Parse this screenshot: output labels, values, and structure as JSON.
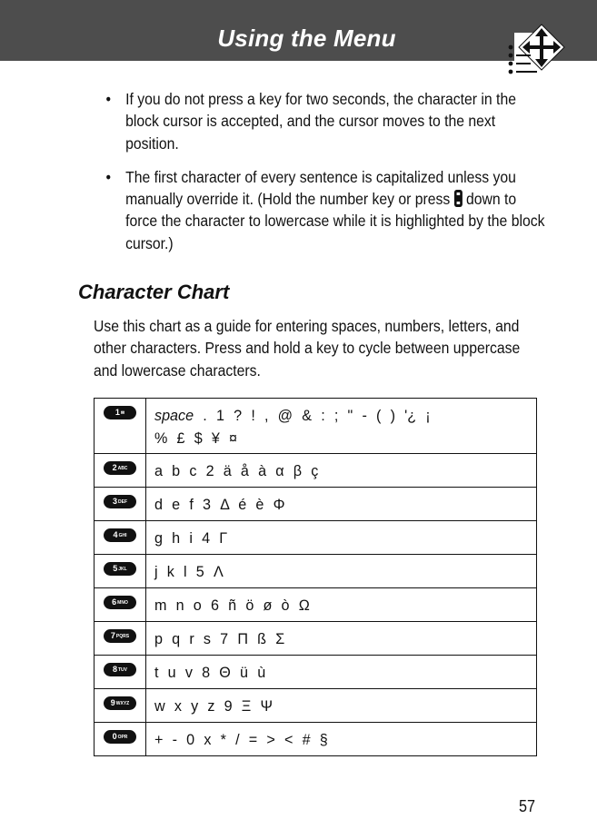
{
  "header": {
    "title": "Using the Menu",
    "icon": "menu-navigation-icon",
    "background_color": "#4d4d4d"
  },
  "bullets": [
    {
      "text": "If you do not press a key for two seconds, the character in the block cursor is accepted, and the cursor moves to the next position."
    },
    {
      "text_before_icon": "The first character of every sentence is capitalized unless you manually override it. (Hold the number key or press ",
      "icon": "navigation-key-icon",
      "text_after_icon": " down to force the character to lowercase while it is highlighted by the block cursor.)"
    }
  ],
  "section": {
    "title": "Character Chart",
    "intro": "Use this chart as a guide for entering spaces, numbers, letters, and other characters. Press and hold a key to cycle between uppercase and lowercase characters."
  },
  "chart_rows": [
    {
      "key": "1",
      "key_sub": "✉",
      "first_italic": "space",
      "chars": ". 1 ? ! , @ & : ; \" - ( ) '¿ ¡",
      "chars_line2": "% £ $ ¥ ¤"
    },
    {
      "key": "2",
      "key_sub": "ABC",
      "chars": "a b c 2 ä å à α β ç"
    },
    {
      "key": "3",
      "key_sub": "DEF",
      "chars": "d e f 3 Δ é è Φ"
    },
    {
      "key": "4",
      "key_sub": "GHI",
      "chars": "g h i 4 Γ"
    },
    {
      "key": "5",
      "key_sub": "JKL",
      "chars": "j k l 5 Λ"
    },
    {
      "key": "6",
      "key_sub": "MNO",
      "chars": "m n o 6 ñ ö ø ò Ω"
    },
    {
      "key": "7",
      "key_sub": "PQRS",
      "chars": "p q r s 7 Π ß Σ"
    },
    {
      "key": "8",
      "key_sub": "TUV",
      "chars": "t u v 8 Θ ü ù"
    },
    {
      "key": "9",
      "key_sub": "WXYZ",
      "chars": "w x y z 9 Ξ Ψ"
    },
    {
      "key": "0",
      "key_sub": "OPR",
      "chars": "+ - 0 x * / = > < # §"
    }
  ],
  "page_number": "57"
}
